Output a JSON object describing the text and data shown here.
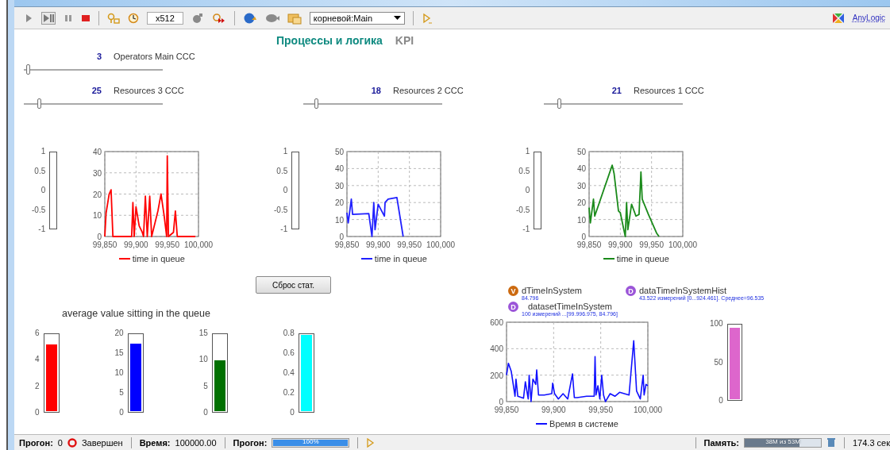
{
  "toolbar": {
    "speed": "x512",
    "root": "корневой:Main",
    "brand": "AnyLogic"
  },
  "tabs": [
    {
      "label": "Процессы и логика",
      "selected": true
    },
    {
      "label": "KPI",
      "selected": false
    }
  ],
  "operators_slider": {
    "value": "3",
    "label": "Operators Main CCC",
    "level": 0.03
  },
  "resource_sliders": [
    {
      "value": "25",
      "label": "Resources 3 CCC",
      "level": 0.11
    },
    {
      "value": "18",
      "label": "Resources 2 CCC",
      "level": 0.09
    },
    {
      "value": "21",
      "label": "Resources 1 CCC",
      "level": 0.11
    }
  ],
  "queue_charts": [
    {
      "indicator_ticks": [
        "1",
        "0.5",
        "0",
        "-0.5",
        "-1"
      ],
      "chart_data": {
        "type": "line",
        "grid": true,
        "x": [
          99850,
          99852,
          99857,
          99860,
          99863,
          99880,
          99893,
          99895,
          99897,
          99900,
          99905,
          99910,
          99912,
          99915,
          99918,
          99922,
          99925,
          99935,
          99940,
          99945,
          99949,
          99950,
          99952,
          99960,
          99963,
          99966,
          99980,
          99995
        ],
        "series": [
          {
            "name": "time in queue",
            "color": "#ff0000",
            "values": [
              0,
              11,
              20,
              22,
              0,
              0,
              0,
              16,
              0,
              14,
              5,
              2,
              0,
              19,
              0,
              19,
              0,
              12,
              20,
              10,
              0,
              38,
              0,
              2,
              12,
              0,
              0,
              0
            ]
          }
        ],
        "xlim": [
          99850,
          100000
        ],
        "ylim": [
          0,
          40
        ],
        "xticks": [
          {
            "value": 99850,
            "label": "99,850"
          },
          {
            "value": 99900,
            "label": "99,900"
          },
          {
            "value": 99950,
            "label": "99,950"
          },
          {
            "value": 100000,
            "label": "100,000"
          }
        ],
        "yticks": [
          0,
          10,
          20,
          30,
          40
        ]
      }
    },
    {
      "indicator_ticks": [
        "1",
        "0.5",
        "0",
        "-0.5",
        "-1"
      ],
      "chart_data": {
        "type": "line",
        "grid": true,
        "x": [
          99850,
          99852,
          99857,
          99859,
          99885,
          99890,
          99893,
          99895,
          99900,
          99910,
          99911,
          99916,
          99930,
          99940
        ],
        "series": [
          {
            "name": "time in queue",
            "color": "#2020ff",
            "values": [
              14,
              8,
              22,
              13,
              13.5,
              0,
              20,
              4,
              19,
              12,
              20,
              22,
              23,
              0
            ]
          }
        ],
        "xlim": [
          99850,
          100000
        ],
        "ylim": [
          0,
          50
        ],
        "xticks": [
          {
            "value": 99850,
            "label": "99,850"
          },
          {
            "value": 99900,
            "label": "99,900"
          },
          {
            "value": 99950,
            "label": "99,950"
          },
          {
            "value": 100000,
            "label": "100,000"
          }
        ],
        "yticks": [
          0,
          10,
          20,
          30,
          40,
          50
        ]
      }
    },
    {
      "indicator_ticks": [
        "1",
        "0.5",
        "0",
        "-0.5",
        "-1"
      ],
      "chart_data": {
        "type": "line",
        "grid": true,
        "x": [
          99850,
          99852,
          99857,
          99859,
          99887,
          99890,
          99897,
          99900,
          99905,
          99908,
          99910,
          99912,
          99918,
          99925,
          99930,
          99933,
          99935,
          99945,
          99958,
          99962
        ],
        "series": [
          {
            "name": "time in queue",
            "color": "#1a8a1a",
            "values": [
              17,
              8,
              22,
              12,
              42,
              37,
              15,
              14,
              5,
              0,
              20,
              4,
              19,
              12,
              13,
              38,
              22,
              13,
              2,
              0
            ]
          }
        ],
        "xlim": [
          99850,
          100000
        ],
        "ylim": [
          0,
          50
        ],
        "xticks": [
          {
            "value": 99850,
            "label": "99,850"
          },
          {
            "value": 99900,
            "label": "99,900"
          },
          {
            "value": 99950,
            "label": "99,950"
          },
          {
            "value": 100000,
            "label": "100,000"
          }
        ],
        "yticks": [
          0,
          10,
          20,
          30,
          40,
          50
        ]
      }
    }
  ],
  "reset_button": "Сброс стат.",
  "average_title": "average value sitting in the queue",
  "average_indicators": [
    {
      "ticks": [
        "6",
        "4",
        "2",
        "0"
      ],
      "level": 0.88,
      "color": "#ff0000"
    },
    {
      "ticks": [
        "20",
        "15",
        "10",
        "5",
        "0"
      ],
      "level": 0.89,
      "color": "#0000ff"
    },
    {
      "ticks": [
        "15",
        "10",
        "5",
        "0"
      ],
      "level": 0.67,
      "color": "#007000"
    },
    {
      "ticks": [
        "0.8",
        "0.6",
        "0.4",
        "0.2",
        "0"
      ],
      "level": 1,
      "color": "#00ffff"
    }
  ],
  "statistics": [
    {
      "kind": "variable",
      "badge": "V",
      "name": "dTimeInSystem",
      "value": "84.796"
    },
    {
      "kind": "dataset",
      "badge": "D",
      "name": "datasetTimeInSystem",
      "value": "100 измерений ...[99.996.975, 84.796]"
    },
    {
      "kind": "dataset",
      "badge": "D",
      "name": "dataTimeInSystemHist",
      "value": "43.522 измерений [0...924.461]. Среднее=96.535"
    }
  ],
  "system_chart": {
    "chart_data": {
      "type": "line",
      "grid": true,
      "x": [
        99850,
        99852,
        99855,
        99859,
        99860,
        99862,
        99868,
        99870,
        99873,
        99874,
        99876,
        99878,
        99881,
        99882,
        99884,
        99890,
        99898,
        99899,
        99901,
        99905,
        99910,
        99915,
        99920,
        99922,
        99925,
        99935,
        99943,
        99944,
        99945,
        99947,
        99949,
        99951,
        99953,
        99955,
        99960,
        99965,
        99970,
        99980,
        99985,
        99988,
        99992,
        99995,
        99996,
        99998,
        100000
      ],
      "series": [
        {
          "name": "Время в системе",
          "color": "#1010ff",
          "values": [
            200,
            290,
            230,
            40,
            170,
            40,
            25,
            150,
            20,
            200,
            0,
            170,
            130,
            240,
            50,
            50,
            60,
            140,
            60,
            20,
            60,
            20,
            210,
            30,
            30,
            40,
            40,
            340,
            50,
            120,
            20,
            200,
            50,
            0,
            60,
            40,
            70,
            50,
            460,
            80,
            20,
            200,
            50,
            130,
            120
          ]
        }
      ],
      "xlim": [
        99850,
        100000
      ],
      "ylim": [
        0,
        600
      ],
      "xticks": [
        {
          "value": 99850,
          "label": "99,850"
        },
        {
          "value": 99900,
          "label": "99,900"
        },
        {
          "value": 99950,
          "label": "99,950"
        },
        {
          "value": 100000,
          "label": "100,000"
        }
      ],
      "yticks": [
        0,
        200,
        400,
        600
      ]
    }
  },
  "histogram_indicator": {
    "ticks": [
      "100",
      "50",
      "0"
    ],
    "level": 0.97,
    "color": "#dd66cc"
  },
  "status_bar": {
    "run_label": "Прогон:",
    "run_number": "0",
    "state": "Завершен",
    "time_label": "Время:",
    "time": "100000.00",
    "progress_label": "Прогон:",
    "progress": {
      "level": 1,
      "text": "100%"
    },
    "memory_label": "Память:",
    "memory": {
      "level": 0.72,
      "text": "38M из 53M"
    },
    "elapsed": "174.3 сек"
  }
}
